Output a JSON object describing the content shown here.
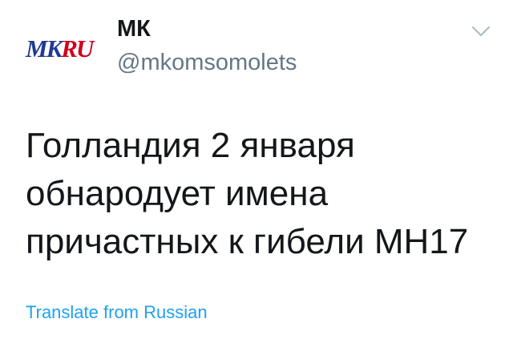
{
  "account": {
    "avatar_logo_text": "MKRU",
    "display_name": "МК",
    "handle": "@mkomsomolets"
  },
  "tweet": {
    "text_lines": [
      "Голландия 2 января",
      "обнародует имена",
      "причастных к гибели MH17"
    ]
  },
  "actions": {
    "translate_label": "Translate from Russian",
    "menu_icon": "chevron-down-icon"
  },
  "colors": {
    "primary_text": "#14171a",
    "secondary_text": "#657786",
    "link": "#1da1f2",
    "logo_blue": "#1f3a93",
    "logo_red": "#d0021b"
  }
}
